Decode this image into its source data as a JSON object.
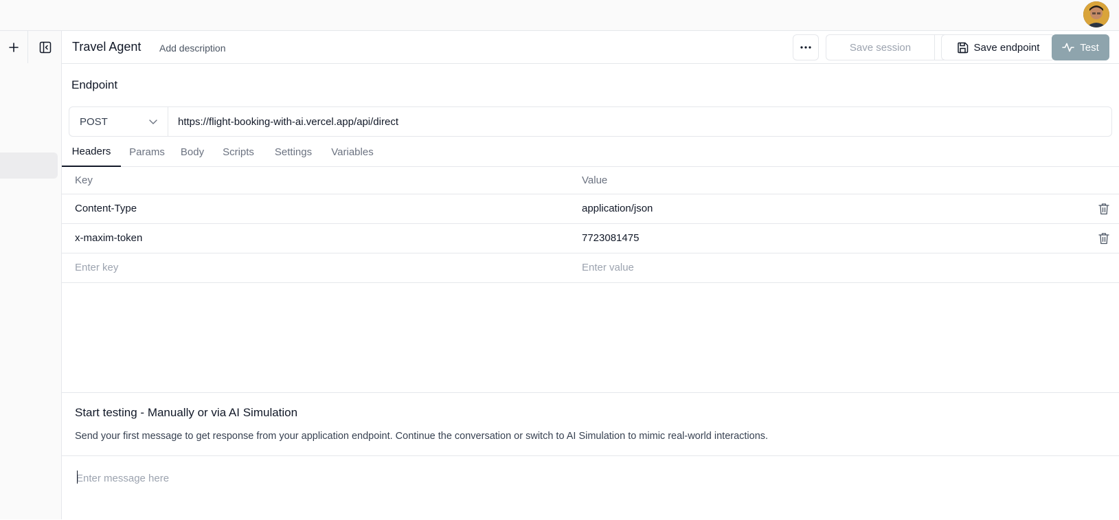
{
  "header": {
    "title": "Travel Agent",
    "add_description": "Add description",
    "save_session": "Save session",
    "save_endpoint": "Save endpoint",
    "test": "Test"
  },
  "endpoint": {
    "label": "Endpoint",
    "method": "POST",
    "url": "https://flight-booking-with-ai.vercel.app/api/direct"
  },
  "tabs": [
    {
      "label": "Headers",
      "active": true
    },
    {
      "label": "Params"
    },
    {
      "label": "Body"
    },
    {
      "label": "Scripts"
    },
    {
      "label": "Settings"
    },
    {
      "label": "Variables"
    }
  ],
  "headers_table": {
    "columns": [
      "Key",
      "Value"
    ],
    "rows": [
      {
        "key": "Content-Type",
        "value": "application/json"
      },
      {
        "key": "x-maxim-token",
        "value": "7723081475"
      }
    ],
    "key_placeholder": "Enter key",
    "value_placeholder": "Enter value"
  },
  "testing": {
    "title": "Start testing - Manually or via AI Simulation",
    "description": "Send your first message to get response from your application endpoint. Continue the conversation or switch to AI Simulation to mimic real-world interactions.",
    "message_placeholder": "Enter message here"
  },
  "icons": [
    "plus-icon",
    "panel-toggle-icon",
    "avatar",
    "more-icon",
    "chevron-down-icon",
    "save-icon",
    "activity-icon",
    "trash-icon"
  ],
  "colors": {
    "test_button": "#8ea4ad",
    "border": "#e5e7eb"
  }
}
